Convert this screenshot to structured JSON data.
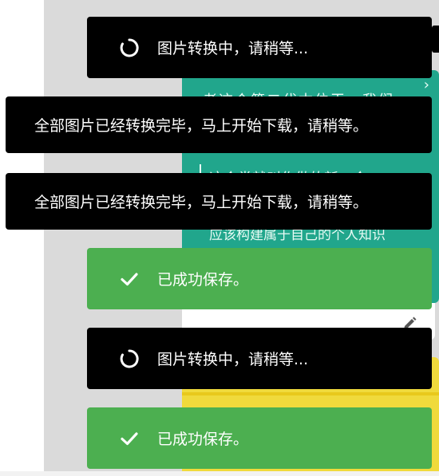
{
  "colors": {
    "background": "#dadada",
    "toast_dark": "#000000",
    "toast_success": "#4caf50",
    "card_green": "#21a68c",
    "card_yellow": "#f0da3c"
  },
  "background_card": {
    "line1": "老这个第二代本位王，我们",
    "line2": "这个类就叫作做的新一个",
    "line3": "应该构建属于自己的个人知识"
  },
  "toasts": [
    {
      "type": "loading",
      "icon": "spinner-icon",
      "text": "图片转换中，请稍等..."
    },
    {
      "type": "info",
      "text": "全部图片已经转换完毕，马上开始下载，请稍等。"
    },
    {
      "type": "info",
      "text": "全部图片已经转换完毕，马上开始下载，请稍等。"
    },
    {
      "type": "success",
      "icon": "check-icon",
      "text": "已成功保存。"
    },
    {
      "type": "loading",
      "icon": "spinner-icon",
      "text": "图片转换中，请稍等..."
    },
    {
      "type": "success",
      "icon": "check-icon",
      "text": "已成功保存。"
    }
  ]
}
